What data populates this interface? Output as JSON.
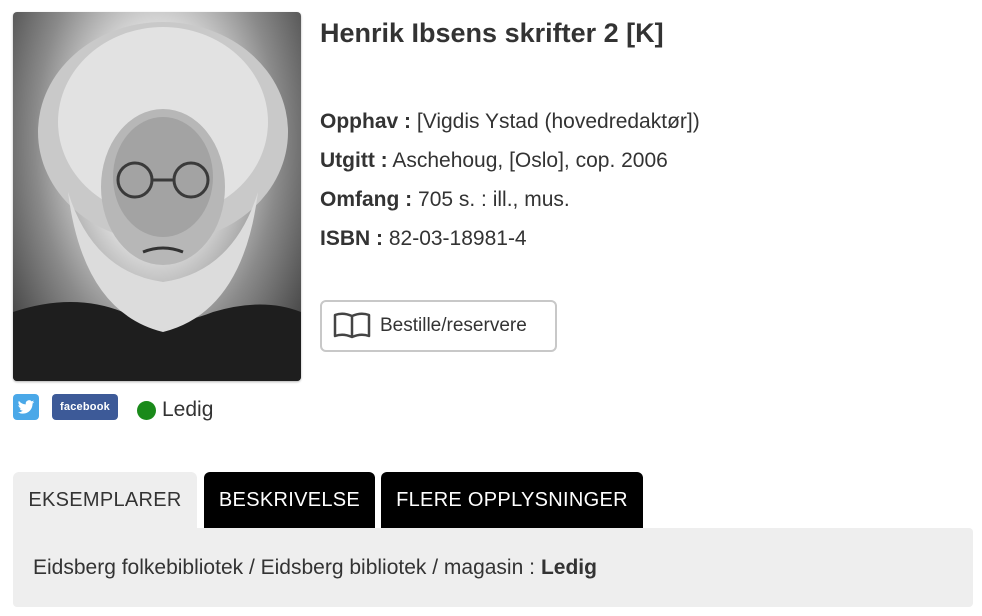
{
  "record": {
    "title": "Henrik Ibsens skrifter 2 [K]",
    "fields": [
      {
        "label": "Opphav :",
        "value": "[Vigdis Ystad (hovedredaktør])"
      },
      {
        "label": "Utgitt :",
        "value": "Aschehoug, [Oslo], cop. 2006"
      },
      {
        "label": "Omfang :",
        "value": "705 s. : ill., mus."
      },
      {
        "label": "ISBN :",
        "value": "82-03-18981-4"
      }
    ]
  },
  "order_button": {
    "label": "Bestille/reservere",
    "icon": "book-icon"
  },
  "social": {
    "twitter_icon": "twitter-icon",
    "facebook_label": "facebook"
  },
  "availability": {
    "status": "Ledig",
    "color": "#1a8a1a"
  },
  "tabs": [
    {
      "label": "EKSEMPLARER",
      "active": true
    },
    {
      "label": "BESKRIVELSE",
      "active": false
    },
    {
      "label": "FLERE OPPLYSNINGER",
      "active": false
    }
  ],
  "holdings": [
    {
      "location": "Eidsberg folkebibliotek / Eidsberg bibliotek / magasin :",
      "status": "Ledig"
    }
  ]
}
